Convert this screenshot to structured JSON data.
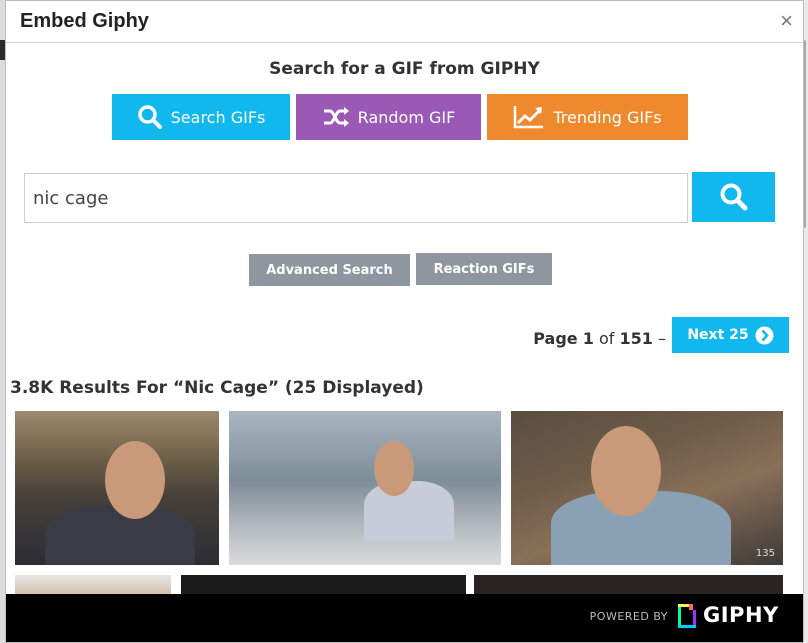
{
  "dialog": {
    "title": "Embed Giphy",
    "close_label": "×"
  },
  "search_section": {
    "heading": "Search for a GIF from GIPHY",
    "modes": [
      {
        "label": "Search GIFs",
        "icon": "search-icon",
        "color": "#11b8ed"
      },
      {
        "label": "Random GIF",
        "icon": "shuffle-icon",
        "color": "#9b59b6"
      },
      {
        "label": "Trending GIFs",
        "icon": "trending-chart-icon",
        "color": "#ee8a2d"
      }
    ],
    "query": "nic cage",
    "advanced_label": "Advanced Search",
    "reaction_label": "Reaction GIFs"
  },
  "pager": {
    "page_prefix": "Page",
    "current": "1",
    "of_label": "of",
    "total": "151",
    "dash": "–",
    "next_label": "Next 25"
  },
  "results": {
    "title": "3.8K Results For “Nic Cage” (25 Displayed)",
    "gif3_watermark": "135"
  },
  "footer": {
    "powered_by": "POWERED BY",
    "brand": "GIPHY"
  },
  "colors": {
    "accent": "#11b8ed",
    "random": "#9b59b6",
    "trending": "#ee8a2d",
    "secondary_button": "#8e979f"
  }
}
